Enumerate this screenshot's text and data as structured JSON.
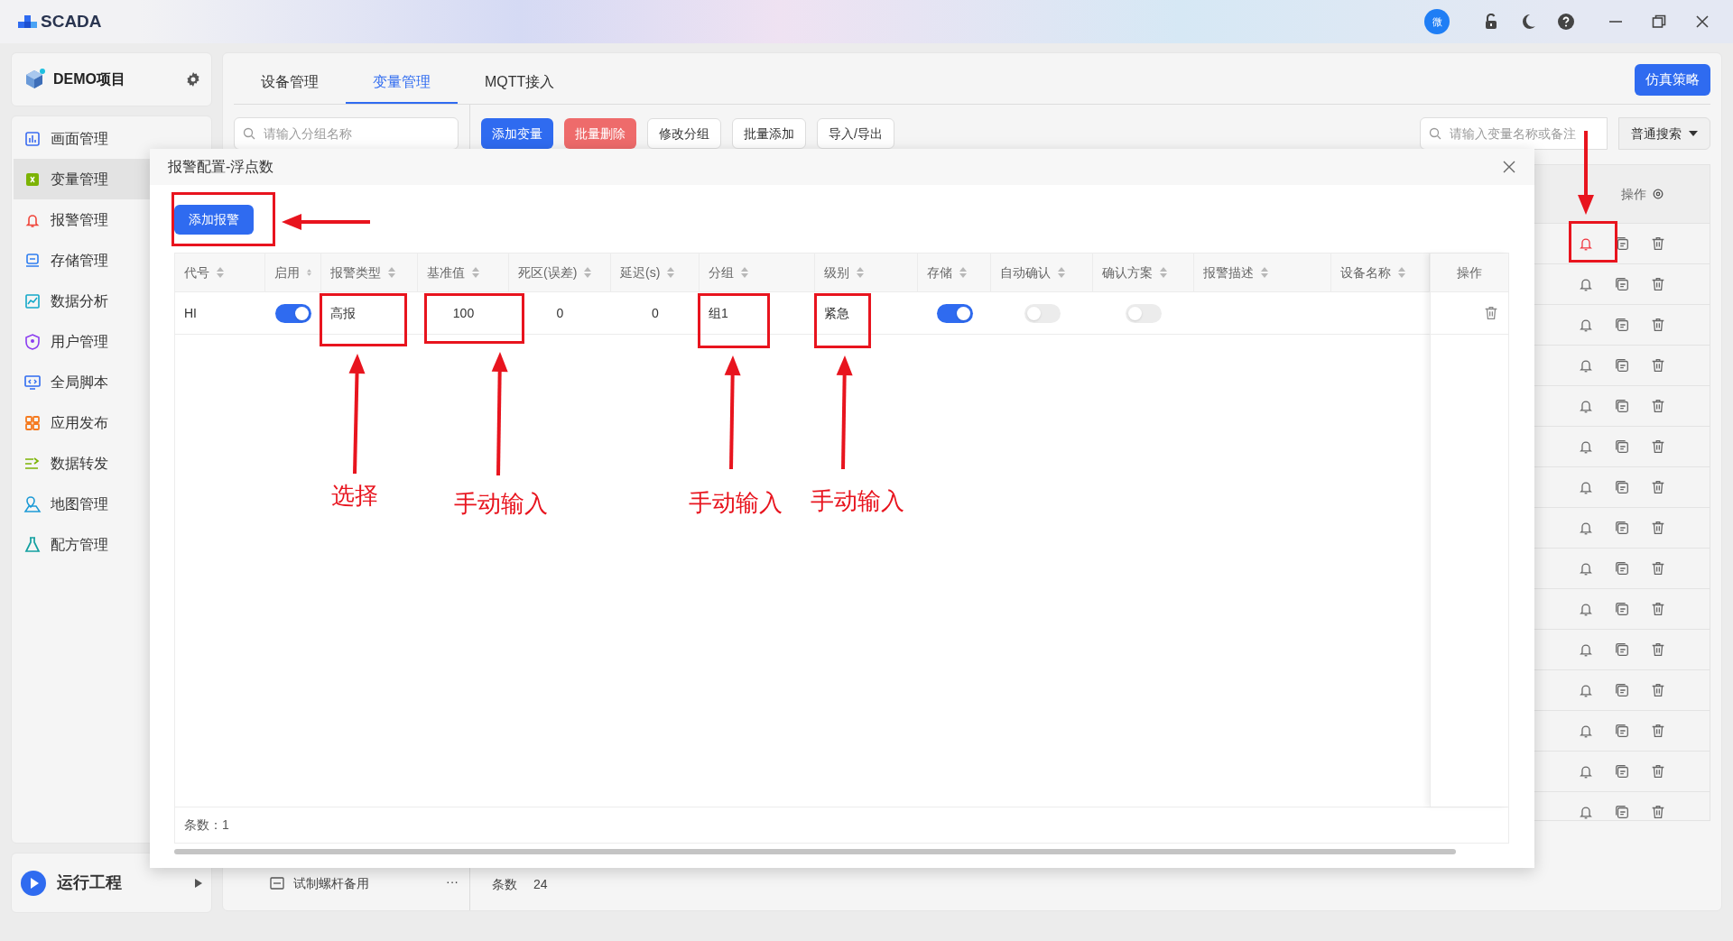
{
  "app": {
    "title": "SCADA"
  },
  "project": {
    "name": "DEMO项目"
  },
  "sidebar": {
    "items": [
      {
        "label": "画面管理",
        "selected": false
      },
      {
        "label": "变量管理",
        "selected": true
      },
      {
        "label": "报警管理",
        "selected": false
      },
      {
        "label": "存储管理",
        "selected": false
      },
      {
        "label": "数据分析",
        "selected": false
      },
      {
        "label": "用户管理",
        "selected": false
      },
      {
        "label": "全局脚本",
        "selected": false
      },
      {
        "label": "应用发布",
        "selected": false
      },
      {
        "label": "数据转发",
        "selected": false
      },
      {
        "label": "地图管理",
        "selected": false
      },
      {
        "label": "配方管理",
        "selected": false
      }
    ],
    "run": {
      "label": "运行工程"
    }
  },
  "user_badge": "微",
  "tabs": [
    {
      "label": "设备管理",
      "selected": false
    },
    {
      "label": "变量管理",
      "selected": true
    },
    {
      "label": "MQTT接入",
      "selected": false
    }
  ],
  "simulate_button": "仿真策略",
  "group_search": {
    "placeholder": "请输入分组名称"
  },
  "toolbar": [
    {
      "label": "添加变量",
      "kind": "primary"
    },
    {
      "label": "批量删除",
      "kind": "danger"
    },
    {
      "label": "修改分组",
      "kind": "plain"
    },
    {
      "label": "批量添加",
      "kind": "plain"
    },
    {
      "label": "导入/导出",
      "kind": "plain"
    }
  ],
  "variable_search": {
    "placeholder": "请输入变量名称或备注"
  },
  "search_mode": "普通搜索",
  "background_table": {
    "ops_header": "操作",
    "rows": [
      {
        "highlighted": true
      },
      {
        "highlighted": false
      },
      {
        "highlighted": false
      },
      {
        "highlighted": false
      },
      {
        "highlighted": false
      },
      {
        "highlighted": false
      },
      {
        "highlighted": false
      },
      {
        "highlighted": false
      },
      {
        "highlighted": false
      },
      {
        "highlighted": false
      },
      {
        "highlighted": false
      },
      {
        "highlighted": false
      },
      {
        "highlighted": false
      },
      {
        "highlighted": false
      },
      {
        "highlighted": false
      }
    ],
    "count_label": "条数",
    "count": "24"
  },
  "group_item": {
    "label": "试制螺杆备用",
    "more": "···"
  },
  "dialog": {
    "title": "报警配置-浮点数",
    "add_button": "添加报警",
    "columns": [
      "代号",
      "启用",
      "报警类型",
      "基准值",
      "死区(误差)",
      "延迟(s)",
      "分组",
      "级别",
      "存储",
      "自动确认",
      "确认方案",
      "报警描述",
      "设备名称"
    ],
    "ops_column": "操作",
    "rows": [
      {
        "cells": [
          {
            "kind": "text",
            "text": "HI"
          },
          {
            "kind": "toggle",
            "on": true
          },
          {
            "kind": "text",
            "text": "高报"
          },
          {
            "kind": "number",
            "text": "100"
          },
          {
            "kind": "number",
            "text": "0"
          },
          {
            "kind": "number",
            "text": "0"
          },
          {
            "kind": "text",
            "text": "组1"
          },
          {
            "kind": "text",
            "text": "紧急"
          },
          {
            "kind": "toggle",
            "on": true
          },
          {
            "kind": "toggle",
            "on": false
          },
          {
            "kind": "toggle",
            "on": false
          },
          {
            "kind": "blank"
          },
          {
            "kind": "blank"
          }
        ]
      }
    ],
    "footer": "条数：1"
  },
  "annotations": {
    "labels": [
      "选择",
      "手动输入",
      "手动输入",
      "手动输入"
    ]
  }
}
